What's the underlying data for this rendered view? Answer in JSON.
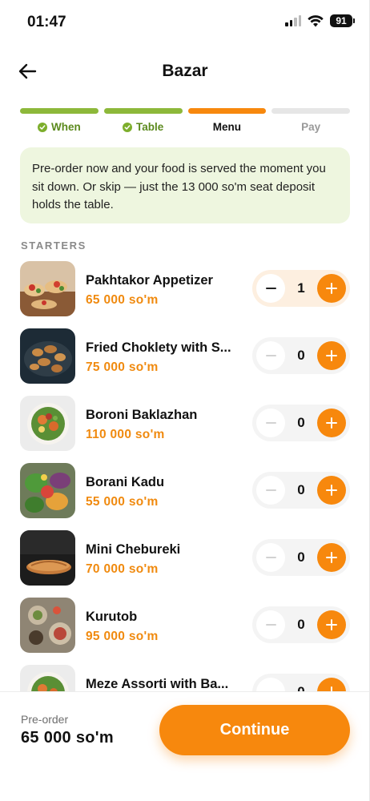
{
  "status": {
    "time": "01:47",
    "battery": "91"
  },
  "header": {
    "title": "Bazar",
    "back_icon": "arrow-left-icon"
  },
  "steps": [
    {
      "label": "When",
      "state": "done"
    },
    {
      "label": "Table",
      "state": "done"
    },
    {
      "label": "Menu",
      "state": "active"
    },
    {
      "label": "Pay",
      "state": "todo"
    }
  ],
  "info": {
    "text": "Pre-order now and your food is served the moment you sit down. Or skip — just the 13 000 so'm seat deposit holds the table."
  },
  "section": {
    "title": "STARTERS"
  },
  "items": [
    {
      "name": "Pakhtakor Appetizer",
      "price": "65 000 so'm",
      "qty": "1"
    },
    {
      "name": "Fried Choklety with S...",
      "price": "75 000 so'm",
      "qty": "0"
    },
    {
      "name": "Boroni Baklazhan",
      "price": "110 000 so'm",
      "qty": "0"
    },
    {
      "name": "Borani Kadu",
      "price": "55 000 so'm",
      "qty": "0"
    },
    {
      "name": "Mini Chebureki",
      "price": "70 000 so'm",
      "qty": "0"
    },
    {
      "name": "Kurutob",
      "price": "95 000 so'm",
      "qty": "0"
    },
    {
      "name": "Meze Assorti with Ba...",
      "price": "",
      "qty": "0"
    }
  ],
  "footer": {
    "pre_label": "Pre-order",
    "total": "65 000 so'm",
    "continue_label": "Continue"
  },
  "colors": {
    "accent": "#f7880d",
    "done": "#8db83a",
    "info_bg": "#eef6df"
  }
}
